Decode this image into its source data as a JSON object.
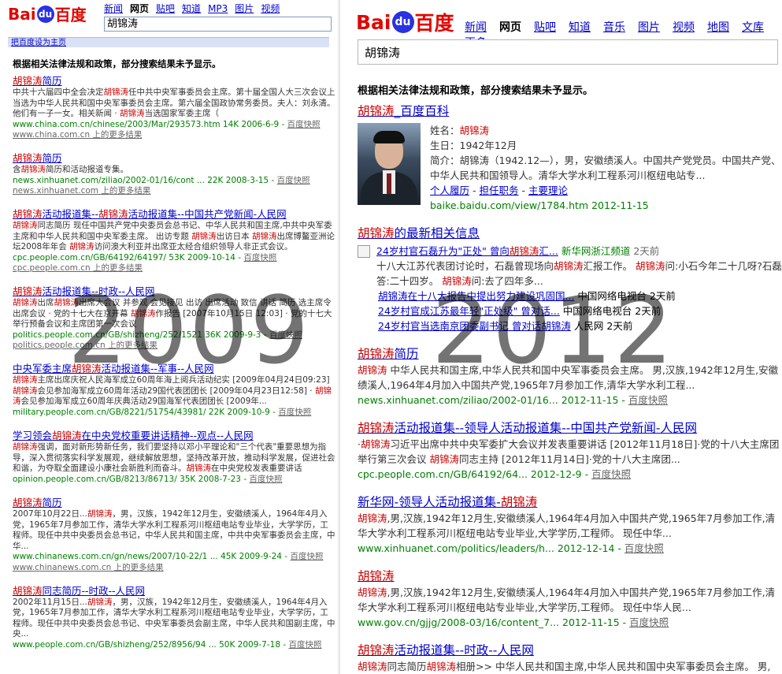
{
  "left": {
    "logo": {
      "bai": "Bai",
      "du": "du",
      "cn": "百度"
    },
    "nav": [
      "新闻",
      "网页",
      "贴吧",
      "知道",
      "MP3",
      "图片",
      "视频"
    ],
    "nav_current": 1,
    "search_value": "胡锦涛",
    "set_homepage": "把百度设为主页",
    "notice": "根据相关法律法规和政策，部分搜索结果未予显示。",
    "results": [
      {
        "title": "胡锦涛简历",
        "desc": "中共十六届四中全会决定胡锦涛任中共中央军事委员会主席。第十届全国人大三次会议上当选为中华人民共和国中央军事委员会主席。第六届全国政协常务委员。夫人：刘永清。他们有一子一女。相关新闻 · 胡锦涛当选国家军委主席（",
        "url": "www.china.com.cn/chinese/2003/Mar/293573.htm 14K 2006-6-9 - ",
        "snap": "百度快照",
        "more": "www.china.com.cn 上的更多结果"
      },
      {
        "title": "胡锦涛简历",
        "desc": "含胡锦涛简历和活动报道专集。",
        "url": "news.xinhuanet.com/ziliao/2002-01/16/cont ... 22K 2008-3-15 - ",
        "snap": "百度快照",
        "more": "news.xinhuanet.com 上的更多结果"
      },
      {
        "title": "胡锦涛活动报道集--胡锦涛活动报道集--中国共产党新闻-人民网",
        "desc": "胡锦涛同志简历 现任中国共产党中央委员会总书记、中华人民共和国主席,中共中央军委主席和中华人民共和国中央军委主席。 出访专题 胡锦涛出访日本 胡锦涛出席博鳌亚洲论坛2008年年会 胡锦涛访问澳大利亚并出席亚太经合组织领导人非正式会议。",
        "url": "cpc.people.com.cn/GB/64192/64197/ 53K 2009-10-14 - ",
        "snap": "百度快照",
        "more": "cpc.people.com.cn 上的更多结果"
      },
      {
        "title": "胡锦涛活动报道集--时政--人民网",
        "desc": "胡锦涛出席胡锦涛出席大会议 并参观 会见接见 出访 出席活动 致信 讲话 简历 选主席令 出席会议 · 党的十七大在京开幕 胡锦涛作报告 [2007年10月15日 12:03] · 党的十七大举行预备会议和主席团第一次会议",
        "url": "politics.people.com.cn/GB/shizheng/252/1521 36K 2009-9-3 - ",
        "snap": "百度快照",
        "more": "politics.people.com.cn 上的更多结果"
      },
      {
        "title": "中央军委主席胡锦涛活动报道集--军事--人民网",
        "desc": "胡锦涛主席出席庆祝人民海军成立60周年海上阅兵活动纪实 [2009年04月24日09:23] 胡锦涛会见参加海军成立60周年活动29国代表团团长 [2009年04月23日12:58] · 胡锦涛会见参加海军成立60周年庆典活动29国海军代表团团长 [2009年...",
        "url": "military.people.com.cn/GB/8221/51754/43981/ 22K 2009-10-9 - ",
        "snap": "百度快照",
        "more": ""
      },
      {
        "title": "学习领会胡锦涛在中央党校重要讲话精神--观点--人民网",
        "desc": "胡锦涛强调，面对新形势新任务，我们要坚持以邓小平理论和\"三个代表\"重要思想为指导，深入贯彻落实科学发展观，继续解放思想，坚持改革开放，推动科学发展，促进社会和谐，为夺取全面建设小康社会新胜利而奋斗。胡锦涛在中央党校发表重要讲话",
        "url": "opinion.people.com.cn/GB/8213/86713/ 35K 2008-7-23 - ",
        "snap": "百度快照",
        "more": ""
      },
      {
        "title": "胡锦涛简历",
        "desc": "2007年10月22日...胡锦涛，男，汉族，1942年12月生，安徽绩溪人，1964年4月入党，1965年7月参加工作，清华大学水利工程系河川枢纽电站专业毕业，大学学历，工程师。现任中共中央委员会总书记，中华人民共和国主席，中共中央军事委员会主席，中华...",
        "url": "www.chinanews.com.cn/gn/news/2007/10-22/1 ... 45K 2009-9-24 - ",
        "snap": "百度快照",
        "more": "www.chinanews.com.cn 上的更多结果"
      },
      {
        "title": "胡锦涛同志简历--时政--人民网",
        "desc": "2002年11月15日...胡锦涛，男，汉族，1942年12月生，安徽绩溪人，1964年4月入党，1965年7月参加工作，清华大学水利工程系河川枢纽电站专业毕业，大学学历，工程师。现任中共中央委员会总书记、中央军事委员会副主席，中华人民共和国副主席，中央...",
        "url": "www.people.com.cn/GB/shizheng/252/8956/94 ... 50K 2009-7-18 - ",
        "snap": "百度快照",
        "more": ""
      }
    ]
  },
  "right": {
    "logo": {
      "bai": "Bai",
      "du": "du",
      "cn": "百度"
    },
    "nav": [
      "新闻",
      "网页",
      "贴吧",
      "知道",
      "音乐",
      "图片",
      "视频",
      "地图",
      "文库",
      "更多»"
    ],
    "nav_current": 1,
    "search_value": "胡锦涛",
    "notice": "根据相关法律法规和政策，部分搜索结果未予显示。",
    "baike": {
      "title": "胡锦涛_百度百科",
      "name_label": "姓名：",
      "name_value": "胡锦涛",
      "birth_label": "生日：",
      "birth_value": "1942年12月",
      "intro_label": "简介：",
      "intro_value": "胡锦涛（1942.12—），男，安徽绩溪人。中国共产党党员。中国共产党、中华人民共和国领导人。清华大学水利工程系河川枢纽电站专...",
      "links": [
        "个人履历",
        "担任职务",
        "主要理论"
      ],
      "url": "baike.baidu.com/view/1784.htm 2012-11-15"
    },
    "news": {
      "title": "胡锦涛的最新相关信息",
      "top": {
        "link": "24岁村官石磊升为\"正处\" 曾向胡锦涛汇...",
        "src": "新华网浙江频道",
        "time": "2天前",
        "desc": "十八大江苏代表团讨论时，石磊曾现场向胡锦涛汇报工作。 胡锦涛问:小石今年二十几呀?石磊答:二十四岁。 胡锦涛问:去了四年多..."
      },
      "items": [
        {
          "link": "胡锦涛在十八大报告中提出努力建设巩固国...",
          "src": "中国网络电视台",
          "time": "2天前"
        },
        {
          "link": "24岁村官成江苏最年轻\"正处级\" 曾对话...",
          "src": "中国网络电视台",
          "time": "2天前"
        },
        {
          "link": "24岁村官当选南京团委副书记 曾对话胡锦涛",
          "src": "人民网",
          "time": "2天前"
        }
      ]
    },
    "results": [
      {
        "title": "胡锦涛简历",
        "desc": "胡锦涛 中华人民共和国主席,中华人民共和国中央军事委员会主席。 男,汉族,1942年12月生,安徽绩溪人,1964年4月加入中国共产党,1965年7月参加工作,清华大学水利工程...",
        "url": "news.xinhuanet.com/ziliao/2002-01/16... 2012-11-15 - ",
        "snap": "百度快照"
      },
      {
        "title": "胡锦涛活动报道集--领导人活动报道集--中国共产党新闻-人民网",
        "desc": "·胡锦涛习近平出席中共中央军委扩大会议并发表重要讲话 [2012年11月18日]·党的十八大主席团举行第三次会议 胡锦涛同志主持 [2012年11月14日]·党的十八大主席团...",
        "url": "cpc.people.com.cn/GB/64192/64... 2012-12-9 - ",
        "snap": "百度快照"
      },
      {
        "title": "新华网-领导人活动报道集-胡锦涛",
        "desc": "胡锦涛,男,汉族,1942年12月生,安徽绩溪人,1964年4月加入中国共产党,1965年7月参加工作,清华大学水利工程系河川枢纽电站专业毕业,大学学历,工程师。 现任中华...",
        "url": "www.xinhuanet.com/politics/leaders/h... 2012-12-14 - ",
        "snap": "百度快照"
      },
      {
        "title": "胡锦涛",
        "desc": "胡锦涛,男,汉族,1942年12月生,安徽绩溪人,1964年4月加入中国共产党,1965年7月参加工作,清华大学水利工程系河川枢纽电站专业毕业,大学学历,工程师。 现任中华人民...",
        "url": "www.gov.cn/gjjg/2008-03/16/content_7... 2012-11-15 - ",
        "snap": "百度快照"
      },
      {
        "title": "胡锦涛活动报道集--时政--人民网",
        "desc": "胡锦涛同志简历胡锦涛相册>> 中华人民共和国主席,中华人民共和国中央军事委员会主席。 男,",
        "url": "",
        "snap": ""
      }
    ]
  },
  "watermark": {
    "left": "2009",
    "right": "2012"
  }
}
